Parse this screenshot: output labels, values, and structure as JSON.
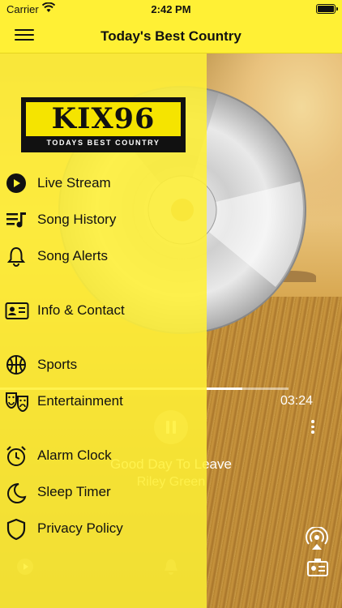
{
  "status_bar": {
    "carrier": "Carrier",
    "time": "2:42 PM"
  },
  "header": {
    "title": "Today's Best Country"
  },
  "drawer": {
    "logo": {
      "name": "KIX96",
      "tagline": "TODAYS BEST COUNTRY"
    },
    "items": [
      {
        "label": "Live Stream",
        "icon": "play-circle-icon"
      },
      {
        "label": "Song History",
        "icon": "music-list-icon"
      },
      {
        "label": "Song Alerts",
        "icon": "bell-icon"
      },
      {
        "label": "Info & Contact",
        "icon": "contact-card-icon"
      },
      {
        "label": "Sports",
        "icon": "basketball-icon"
      },
      {
        "label": "Entertainment",
        "icon": "theater-masks-icon"
      },
      {
        "label": "Alarm Clock",
        "icon": "alarm-clock-icon"
      },
      {
        "label": "Sleep Timer",
        "icon": "moon-icon"
      },
      {
        "label": "Privacy Policy",
        "icon": "shield-icon"
      }
    ]
  },
  "player": {
    "elapsed": "03:24",
    "progress": 0.84,
    "song_title": "Good Day To Leave",
    "artist": "Riley Green"
  },
  "colors": {
    "accent": "#fff035",
    "text": "#111111"
  }
}
